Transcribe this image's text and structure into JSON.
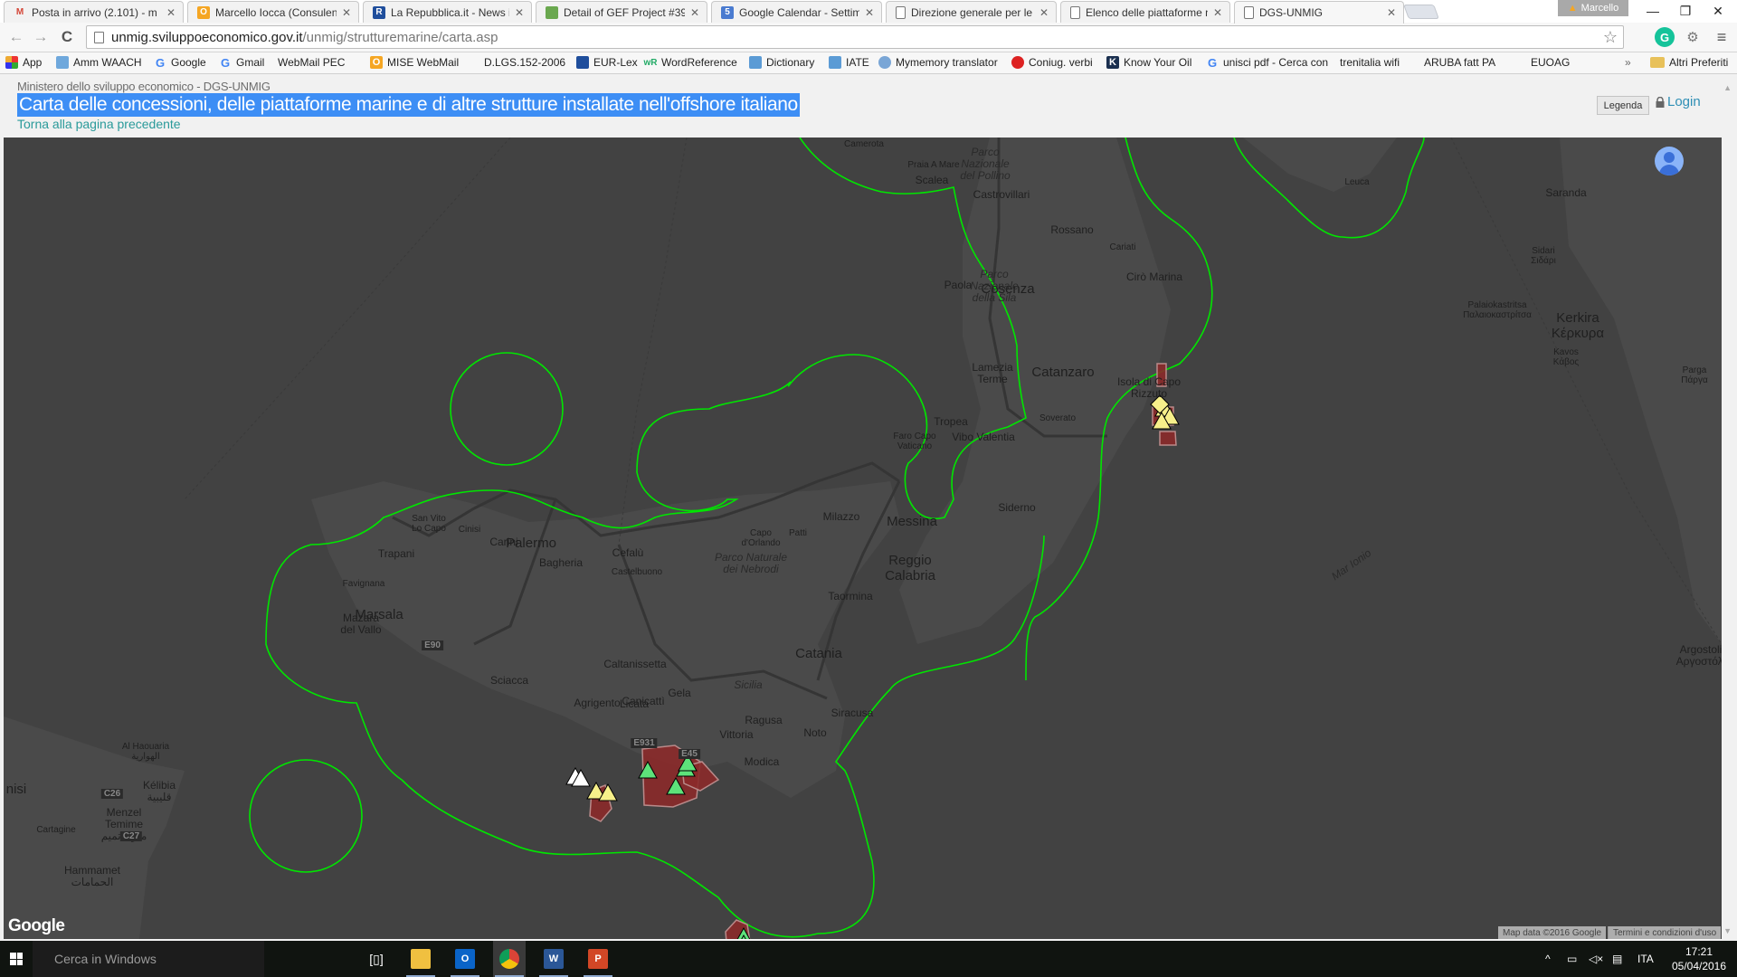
{
  "browser": {
    "tabs": [
      {
        "title": "Posta in arrivo (2.101) - m",
        "icon": "gmail-icon",
        "icon_text": "M",
        "icon_color": "#d44638"
      },
      {
        "title": "Marcello Iocca (Consulent",
        "icon": "outlook-office-icon",
        "icon_text": "O",
        "icon_color": "#f5a623"
      },
      {
        "title": "La Repubblica.it - News in",
        "icon": "repubblica-icon",
        "icon_text": "R",
        "icon_color": "#1f4e9c"
      },
      {
        "title": "Detail of GEF Project #398",
        "icon": "globe-icon",
        "icon_text": "",
        "icon_color": "#6aa84f"
      },
      {
        "title": "Google Calendar - Settima",
        "icon": "calendar-icon",
        "icon_text": "5",
        "icon_color": "#4a7bd0"
      },
      {
        "title": "Direzione generale per le",
        "icon": "page-icon",
        "icon_text": "",
        "icon_color": ""
      },
      {
        "title": "Elenco delle piattaforme n",
        "icon": "page-icon",
        "icon_text": "",
        "icon_color": ""
      },
      {
        "title": "DGS-UNMIG",
        "icon": "page-icon",
        "icon_text": "",
        "icon_color": "",
        "active": true
      }
    ],
    "profile_name": "Marcello",
    "url_host": "unmig.sviluppoeconomico.gov.it",
    "url_path": "/unmig/strutturemarine/carta.asp",
    "bookmarks": [
      {
        "label": "App",
        "icon": "apps-grid-icon"
      },
      {
        "label": "Amm WAACH",
        "icon": "mail-icon"
      },
      {
        "label": "Google",
        "icon": "google-icon"
      },
      {
        "label": "Gmail",
        "icon": "google-icon"
      },
      {
        "label": "WebMail PEC",
        "icon": "page-icon"
      },
      {
        "label": "MISE WebMail",
        "icon": "office-icon"
      },
      {
        "label": "D.LGS.152-2006",
        "icon": "page-icon"
      },
      {
        "label": "EUR-Lex",
        "icon": "eurlex-icon"
      },
      {
        "label": "WordReference",
        "icon": "wordreference-icon"
      },
      {
        "label": "Dictionary",
        "icon": "dictionary-icon"
      },
      {
        "label": "IATE",
        "icon": "iate-icon"
      },
      {
        "label": "Mymemory translator",
        "icon": "globe-icon"
      },
      {
        "label": "Coniug. verbi",
        "icon": "coniug-icon"
      },
      {
        "label": "Know Your Oil",
        "icon": "kyo-icon"
      },
      {
        "label": "unisci pdf - Cerca con",
        "icon": "google-icon"
      },
      {
        "label": "trenitalia wifi",
        "icon": "page-icon"
      },
      {
        "label": "ARUBA fatt PA",
        "icon": "aruba-icon"
      },
      {
        "label": "EUOAG",
        "icon": "page-icon"
      }
    ],
    "bookmarks_overflow": "»",
    "other_bookmarks": "Altri Preferiti"
  },
  "page": {
    "ministry": "Ministero dello sviluppo economico - DGS-UNMIG",
    "title": "Carta delle concessioni, delle piattaforme marine e di altre strutture installate nell'offshore italiano",
    "back_link": "Torna alla pagina precedente",
    "legend_button": "Legenda",
    "login_link": "Login"
  },
  "map": {
    "boundary_color": "#00e600",
    "concession_color": "#8b2a2a",
    "platform_colors": {
      "green": "#5de27a",
      "yellow": "#f7f08a",
      "white": "#ffffff"
    },
    "labels": [
      {
        "text": "Camerota",
        "kind": "small"
      },
      {
        "text": "Praia A Mare",
        "kind": "small"
      },
      {
        "text": "Parco\nNazionale\ndel Pollino",
        "kind": "park"
      },
      {
        "text": "Scalea",
        "kind": "normal"
      },
      {
        "text": "Castrovillari",
        "kind": "normal"
      },
      {
        "text": "Rossano",
        "kind": "normal"
      },
      {
        "text": "Cariati",
        "kind": "small"
      },
      {
        "text": "Cirò Marina",
        "kind": "normal"
      },
      {
        "text": "Paola",
        "kind": "normal"
      },
      {
        "text": "Cosenza",
        "kind": "big"
      },
      {
        "text": "Parco\nNazionale\ndella Sila",
        "kind": "park"
      },
      {
        "text": "Lamezia\nTerme",
        "kind": "normal"
      },
      {
        "text": "Catanzaro",
        "kind": "big"
      },
      {
        "text": "Isola di Capo\nRizzuto",
        "kind": "normal"
      },
      {
        "text": "Tropea",
        "kind": "normal"
      },
      {
        "text": "Faro Capo\nVaticano",
        "kind": "small"
      },
      {
        "text": "Vibo Valentia",
        "kind": "normal"
      },
      {
        "text": "Soverato",
        "kind": "small"
      },
      {
        "text": "Siderno",
        "kind": "normal"
      },
      {
        "text": "Milazzo",
        "kind": "normal"
      },
      {
        "text": "Messina",
        "kind": "big"
      },
      {
        "text": "Capo\nd'Orlando",
        "kind": "small"
      },
      {
        "text": "Patti",
        "kind": "small"
      },
      {
        "text": "Reggio\nCalabria",
        "kind": "big"
      },
      {
        "text": "Parco Naturale\ndei Nebrodi",
        "kind": "park"
      },
      {
        "text": "Taormina",
        "kind": "normal"
      },
      {
        "text": "Catania",
        "kind": "big"
      },
      {
        "text": "Sicilia",
        "kind": "park"
      },
      {
        "text": "Siracusa",
        "kind": "normal"
      },
      {
        "text": "Noto",
        "kind": "normal"
      },
      {
        "text": "Ragusa",
        "kind": "normal"
      },
      {
        "text": "Vittoria",
        "kind": "normal"
      },
      {
        "text": "Modica",
        "kind": "normal"
      },
      {
        "text": "Gela",
        "kind": "normal"
      },
      {
        "text": "Licata",
        "kind": "normal"
      },
      {
        "text": "Caltanissetta",
        "kind": "normal"
      },
      {
        "text": "Agrigento",
        "kind": "normal"
      },
      {
        "text": "Canicattì",
        "kind": "normal"
      },
      {
        "text": "Sciacca",
        "kind": "normal"
      },
      {
        "text": "Mazara\ndel Vallo",
        "kind": "normal"
      },
      {
        "text": "Marsala",
        "kind": "big"
      },
      {
        "text": "Favignana",
        "kind": "small"
      },
      {
        "text": "Trapani",
        "kind": "normal"
      },
      {
        "text": "San Vito\nLo Capo",
        "kind": "small"
      },
      {
        "text": "Cinisi",
        "kind": "small"
      },
      {
        "text": "Carini",
        "kind": "normal"
      },
      {
        "text": "Palermo",
        "kind": "big"
      },
      {
        "text": "Bagheria",
        "kind": "normal"
      },
      {
        "text": "Cefalù",
        "kind": "normal"
      },
      {
        "text": "Castelbuono",
        "kind": "small"
      },
      {
        "text": "Al Haouaria\nالهوارية",
        "kind": "small"
      },
      {
        "text": "Kélibia\nقليبية",
        "kind": "normal"
      },
      {
        "text": "Menzel\nTemime\nمنزل تميم",
        "kind": "normal"
      },
      {
        "text": "Cartagine",
        "kind": "small"
      },
      {
        "text": "nisi",
        "kind": "big"
      },
      {
        "text": "Hammamet\nالحمامات",
        "kind": "normal"
      },
      {
        "text": "Leuca",
        "kind": "small"
      },
      {
        "text": "Saranda",
        "kind": "normal"
      },
      {
        "text": "Sidari\nΣιδάρι",
        "kind": "small"
      },
      {
        "text": "Palaiokastritsa\nΠαλαιοκαστρίτσα",
        "kind": "small"
      },
      {
        "text": "Kerkira\nΚέρκυρα",
        "kind": "big"
      },
      {
        "text": "Kavos\nΚάβος",
        "kind": "small"
      },
      {
        "text": "Parga\nΠάργα",
        "kind": "small"
      },
      {
        "text": "Argostoli\nΑργοστόλι",
        "kind": "normal"
      },
      {
        "text": "Mar Ionio",
        "kind": "sea"
      }
    ],
    "road_shields": [
      "E931",
      "E45",
      "E90",
      "C26",
      "C27"
    ],
    "google_logo": "Google",
    "map_data": "Map data ©2016 Google",
    "terms": "Termini e condizioni d'uso"
  },
  "taskbar": {
    "search_placeholder": "Cerca in Windows",
    "apps": [
      "task-view",
      "file-explorer",
      "outlook",
      "chrome",
      "word",
      "powerpoint"
    ],
    "language": "ITA",
    "time": "17:21",
    "date": "05/04/2016"
  }
}
